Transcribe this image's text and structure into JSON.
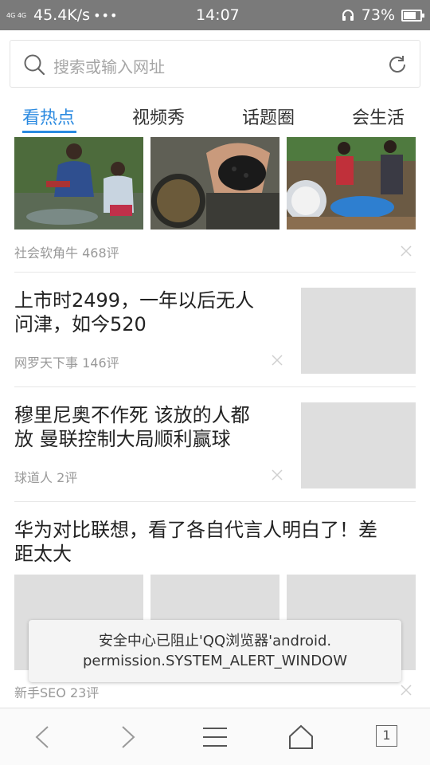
{
  "status": {
    "signal": "4G 4G",
    "speed": "45.4K/s",
    "dots": "•••",
    "time": "14:07",
    "battery": "73%",
    "battery_level": 0.73
  },
  "search": {
    "placeholder": "搜索或输入网址"
  },
  "tabs": [
    {
      "label": "看热点",
      "active": true
    },
    {
      "label": "视频秀",
      "active": false
    },
    {
      "label": "话题圈",
      "active": false
    },
    {
      "label": "会生活",
      "active": false
    }
  ],
  "feed": [
    {
      "meta": "社会软角牛 468评"
    },
    {
      "title_line1": "上市时2499，一年以后无人",
      "title_line2": "问津，如今520",
      "meta": "网罗天下事 146评"
    },
    {
      "title_line1": "穆里尼奥不作死 该放的人都",
      "title_line2": "放 曼联控制大局顺利赢球",
      "meta": "球道人 2评"
    },
    {
      "title_line1": "华为对比联想，看了各自代言人明白了！差",
      "title_line2": "距太大",
      "meta": "新手SEO 23评"
    }
  ],
  "toast": {
    "line1": "安全中心已阻止'QQ浏览器'android.",
    "line2": "permission.SYSTEM_ALERT_WINDOW"
  },
  "bottom": {
    "tab_count": "1"
  },
  "colors": {
    "accent": "#2b8ae0",
    "statusbar": "#7a7a7a"
  }
}
